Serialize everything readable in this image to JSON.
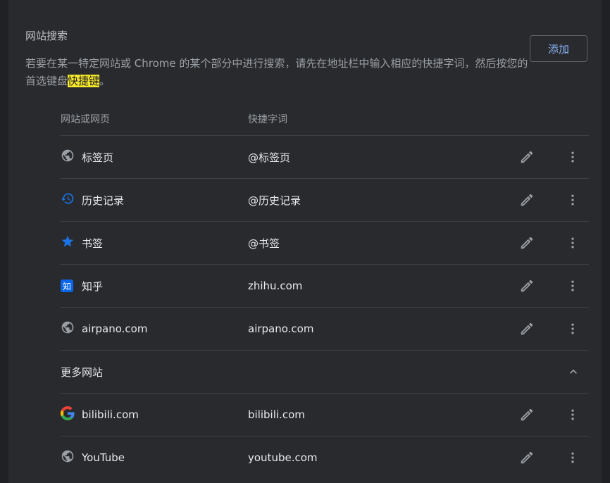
{
  "section": {
    "title": "网站搜索",
    "desc_before": "若要在某一特定网站或 Chrome 的某个部分中进行搜索，请先在地址栏中输入相应的快捷字词，然后按您的首选键盘",
    "desc_highlight": "快捷键",
    "desc_after": "。",
    "add_label": "添加"
  },
  "table": {
    "col_site": "网站或网页",
    "col_shortcut": "快捷字词"
  },
  "rows": [
    {
      "name": "标签页",
      "shortcut": "@标签页",
      "icon": "globe-icon"
    },
    {
      "name": "历史记录",
      "shortcut": "@历史记录",
      "icon": "history-icon"
    },
    {
      "name": "书签",
      "shortcut": "@书签",
      "icon": "star-icon"
    },
    {
      "name": "知乎",
      "shortcut": "zhihu.com",
      "icon": "zhihu-icon",
      "icon_text": "知"
    },
    {
      "name": "airpano.com",
      "shortcut": "airpano.com",
      "icon": "globe-icon"
    }
  ],
  "more": {
    "title": "更多网站",
    "rows": [
      {
        "name": "bilibili.com",
        "shortcut": "bilibili.com",
        "icon": "google-icon"
      },
      {
        "name": "YouTube",
        "shortcut": "youtube.com",
        "icon": "globe-icon"
      }
    ]
  },
  "colors": {
    "accent": "#8ab4f8",
    "highlight": "#f7e92a",
    "icon_blue": "#1a73e8"
  }
}
